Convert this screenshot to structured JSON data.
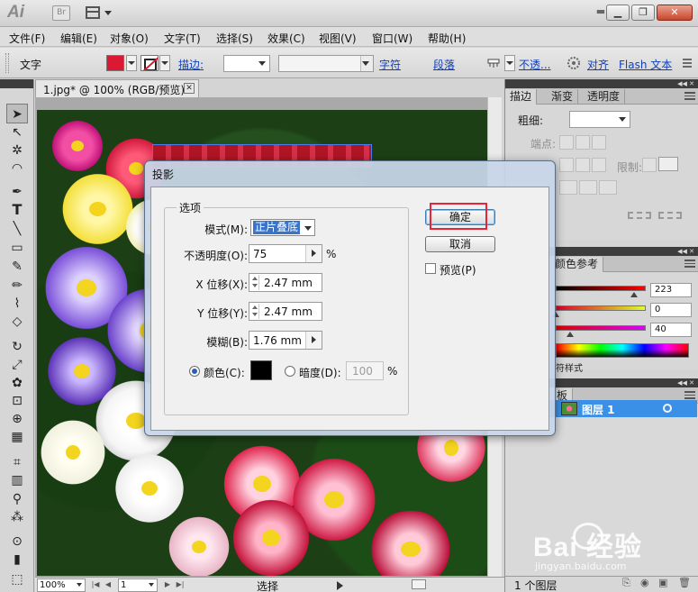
{
  "titlebar": {
    "app_logo": "Ai",
    "bridge_label": "Br",
    "icons": [
      "arrange-documents-icon",
      "minimize-icon",
      "restore-icon",
      "close-icon"
    ]
  },
  "menu": [
    "文件(F)",
    "编辑(E)",
    "对象(O)",
    "文字(T)",
    "选择(S)",
    "效果(C)",
    "视图(V)",
    "窗口(W)",
    "帮助(H)"
  ],
  "control_bar": {
    "tool_name": "文字",
    "fill_color": "#dc1933",
    "stroke_label": "描边:",
    "character_link": "字符",
    "paragraph_link": "段落",
    "opacity_link": "不透...",
    "align_link": "对齐",
    "flash_link": "Flash 文本"
  },
  "document": {
    "tab_title": "1.jpg* @ 100% (RGB/预览)"
  },
  "status_bar": {
    "zoom": "100%",
    "artboard": "1",
    "current_tool": "选择"
  },
  "stroke_panel": {
    "tabs": [
      "描边",
      "渐变",
      "透明度"
    ],
    "weight_label": "粗细:",
    "cap_label": "端点:",
    "limit_label": "限制:"
  },
  "color_panel": {
    "tab": "颜色参考",
    "r": "223",
    "g": "0",
    "b": "40",
    "r_level": 0.87,
    "g_level": 0.0,
    "b_level": 0.16
  },
  "layers_panel": {
    "tab": "板",
    "layer_name": "图层 1",
    "footer": "1 个图层",
    "behind_label": "符样式"
  },
  "dialog": {
    "title": "投影",
    "group_label": "选项",
    "mode_label": "模式(M):",
    "mode_value": "正片叠底",
    "opacity_label": "不透明度(O):",
    "opacity_value": "75",
    "percent": "%",
    "x_offset_label": "X 位移(X):",
    "x_offset_value": "2.47 mm",
    "y_offset_label": "Y 位移(Y):",
    "y_offset_value": "2.47 mm",
    "blur_label": "模糊(B):",
    "blur_value": "1.76 mm",
    "color_label": "颜色(C):",
    "shadow_color": "#000000",
    "darkness_label": "暗度(D):",
    "darkness_value": "100",
    "ok_label": "确定",
    "cancel_label": "取消",
    "preview_label": "预览(P)"
  },
  "watermark": {
    "text": "Bai  经验",
    "url": "jingyan.baidu.com"
  }
}
